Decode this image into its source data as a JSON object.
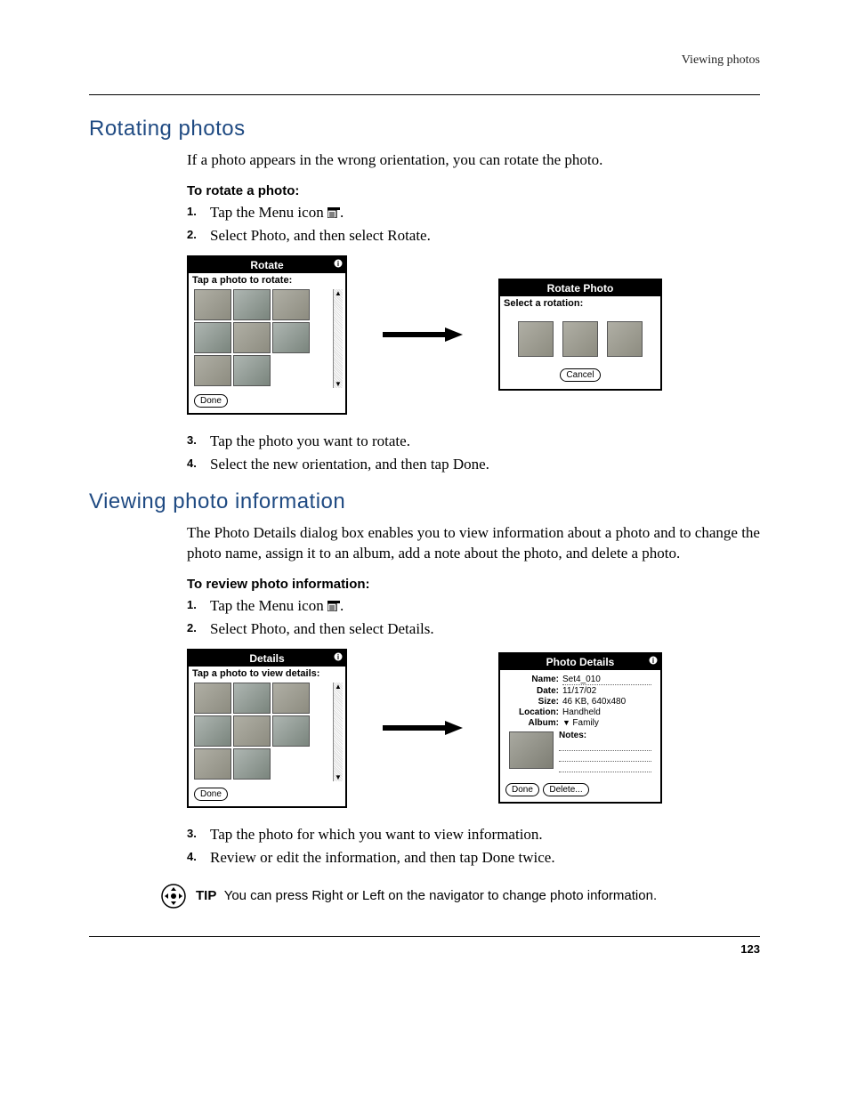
{
  "running_head": "Viewing photos",
  "page_number": "123",
  "rotating": {
    "heading": "Rotating photos",
    "intro": "If a photo appears in the wrong orientation, you can rotate the photo.",
    "subhead": "To rotate a photo:",
    "step1_a": "Tap the Menu icon ",
    "step1_b": ".",
    "step2": "Select Photo, and then select Rotate.",
    "step3": "Tap the photo you want to rotate.",
    "step4": "Select the new orientation, and then tap Done."
  },
  "rotate_panel_left": {
    "title": "Rotate",
    "prompt": "Tap a photo to rotate:",
    "done": "Done"
  },
  "rotate_panel_right": {
    "title": "Rotate Photo",
    "prompt": "Select a rotation:",
    "cancel": "Cancel"
  },
  "viewing_info": {
    "heading": "Viewing photo information",
    "intro": "The Photo Details dialog box enables you to view information about a photo and to change the photo name, assign it to an album, add a note about the photo, and delete a photo.",
    "subhead": "To review photo information:",
    "step1_a": "Tap the Menu icon ",
    "step1_b": ".",
    "step2": "Select Photo, and then select Details.",
    "step3": "Tap the photo for which you want to view information.",
    "step4": "Review or edit the information, and then tap Done twice."
  },
  "details_panel_left": {
    "title": "Details",
    "prompt": "Tap a photo to view details:",
    "done": "Done"
  },
  "details_panel_right": {
    "title": "Photo Details",
    "labels": {
      "name": "Name:",
      "date": "Date:",
      "size": "Size:",
      "location": "Location:",
      "album": "Album:",
      "notes": "Notes:"
    },
    "values": {
      "name": "Set4_010",
      "date": "11/17/02",
      "size": "46 KB, 640x480",
      "location": "Handheld",
      "album": "Family"
    },
    "done": "Done",
    "delete": "Delete..."
  },
  "tip": {
    "label": "TIP",
    "text": "You can press Right or Left on the navigator to change photo information."
  }
}
